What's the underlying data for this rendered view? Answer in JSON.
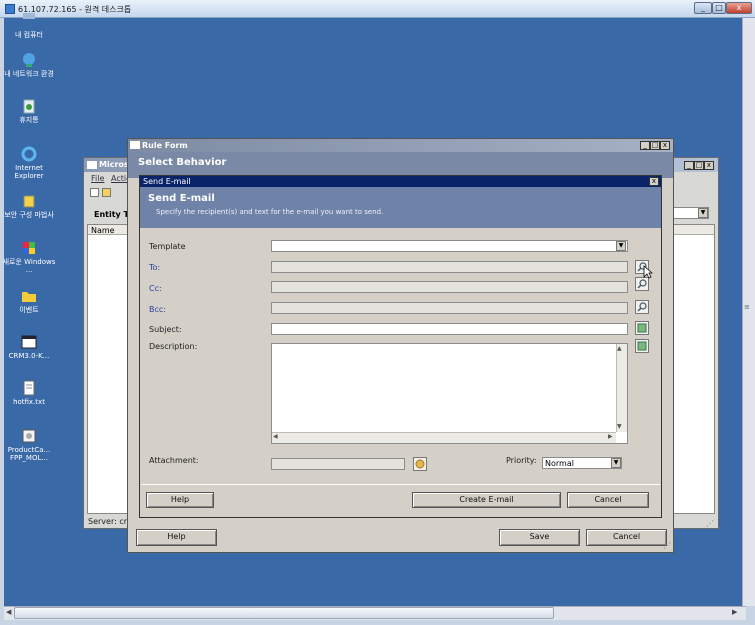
{
  "outer": {
    "title": "61.107.72.165 - 원격 데스크톱",
    "min": "_",
    "max": "□",
    "close": "x"
  },
  "desktop_icons": [
    {
      "label": "내 컴퓨터",
      "icon": "computer-icon"
    },
    {
      "label": "내 네트워크 환경",
      "icon": "network-icon"
    },
    {
      "label": "휴지통",
      "icon": "recycle-bin-icon"
    },
    {
      "label": "Internet Explorer",
      "icon": "ie-icon"
    },
    {
      "label": "보안 구성 마법사",
      "icon": "wizard-icon"
    },
    {
      "label": "새로운 Windows ...",
      "icon": "windows-icon"
    },
    {
      "label": "이벤트",
      "icon": "folder-icon"
    },
    {
      "label": "CRM3.0-K...",
      "icon": "window-icon"
    },
    {
      "label": "hotfix.txt",
      "icon": "text-file-icon"
    },
    {
      "label": "ProductCa... FPP_MOL...",
      "icon": "cd-icon"
    }
  ],
  "crm_window": {
    "title": "Micros",
    "menu": [
      "File",
      "Actio"
    ],
    "entity_label": "Entity Ty",
    "col_name": "Name",
    "status": "Server: crm"
  },
  "rule_form": {
    "title": "Rule Form",
    "header": "Select Behavior",
    "help": "Help",
    "save": "Save",
    "cancel": "Cancel"
  },
  "send_email": {
    "title": "Send E-mail",
    "heading": "Send E-mail",
    "subtitle": "Specify the recipient(s) and text for the e-mail you want to send.",
    "template_label": "Template",
    "to_label": "To:",
    "cc_label": "Cc:",
    "bcc_label": "Bcc:",
    "subject_label": "Subject:",
    "description_label": "Description:",
    "attachment_label": "Attachment:",
    "priority_label": "Priority:",
    "priority_value": "Normal",
    "help": "Help",
    "create": "Create E-mail",
    "cancel": "Cancel"
  }
}
